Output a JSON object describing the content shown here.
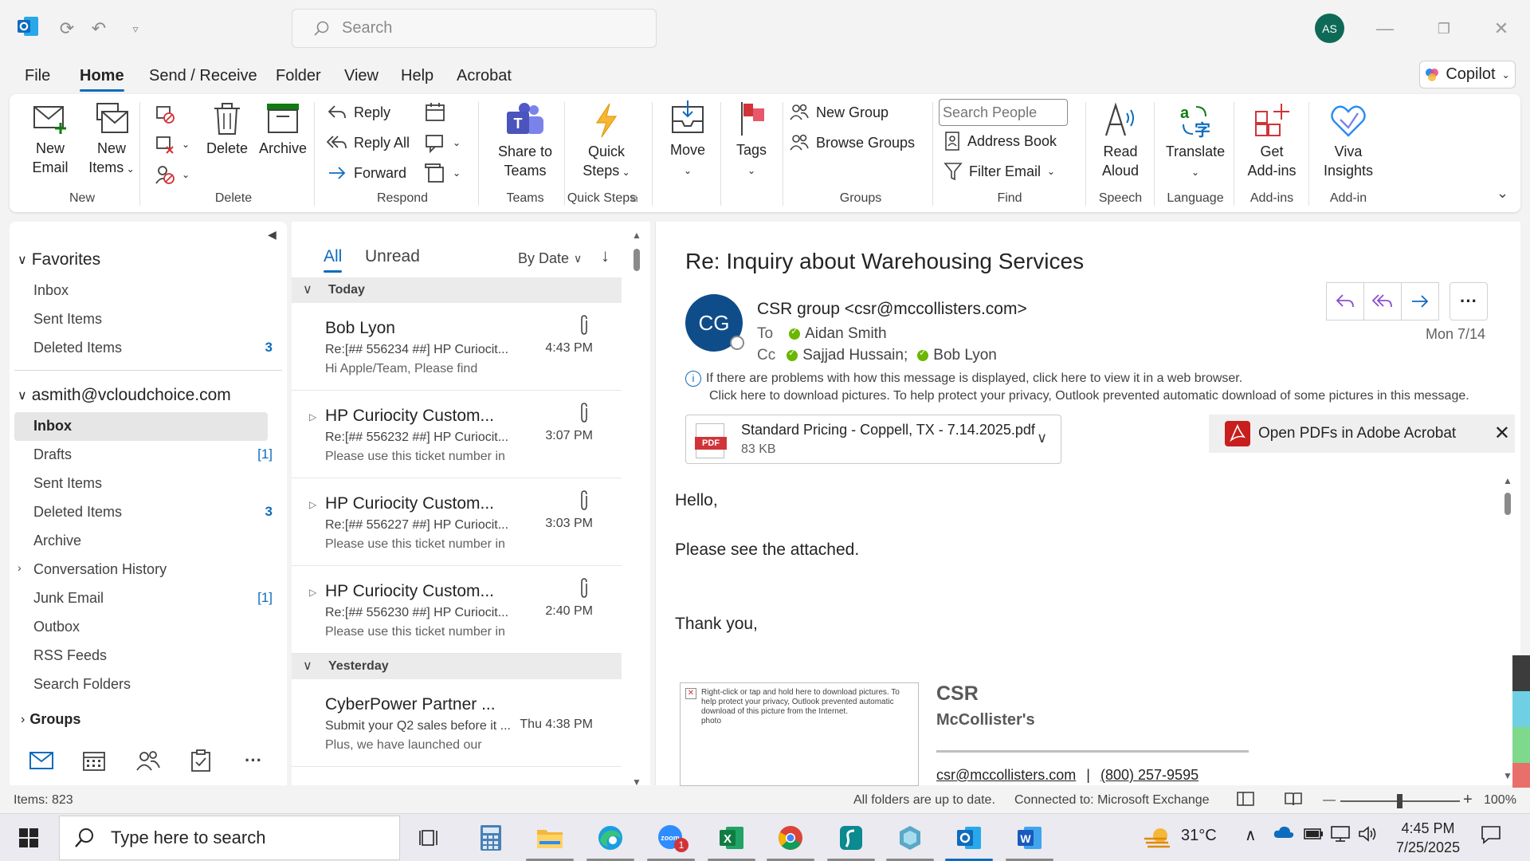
{
  "titlebar": {
    "search_placeholder": "Search",
    "avatar_initials": "AS"
  },
  "menu": {
    "tabs": [
      "File",
      "Home",
      "Send / Receive",
      "Folder",
      "View",
      "Help",
      "Acrobat"
    ],
    "active": "Home",
    "copilot_label": "Copilot"
  },
  "ribbon": {
    "new_email": [
      "New",
      "Email"
    ],
    "new_items": [
      "New",
      "Items"
    ],
    "delete": "Delete",
    "archive": "Archive",
    "reply": "Reply",
    "reply_all": "Reply All",
    "forward": "Forward",
    "share_to_teams": [
      "Share to",
      "Teams"
    ],
    "quick_steps": [
      "Quick",
      "Steps"
    ],
    "move": "Move",
    "tags": "Tags",
    "new_group": "New Group",
    "browse_groups": "Browse Groups",
    "search_people_placeholder": "Search People",
    "address_book": "Address Book",
    "filter_email": "Filter Email",
    "read_aloud": [
      "Read",
      "Aloud"
    ],
    "translate": "Translate",
    "get_addins": [
      "Get",
      "Add-ins"
    ],
    "viva_insights": [
      "Viva",
      "Insights"
    ],
    "groups": {
      "new": "New",
      "delete": "Delete",
      "respond": "Respond",
      "teams": "Teams",
      "quick_steps": "Quick Steps",
      "groups": "Groups",
      "find": "Find",
      "speech": "Speech",
      "language": "Language",
      "addins": "Add-ins",
      "addin": "Add-in"
    }
  },
  "folders": {
    "favorites_header": "Favorites",
    "favorites": [
      {
        "name": "Inbox",
        "count": ""
      },
      {
        "name": "Sent Items",
        "count": ""
      },
      {
        "name": "Deleted Items",
        "count": "3"
      }
    ],
    "account_header": "asmith@vcloudchoice.com",
    "account_folders": [
      {
        "name": "Inbox",
        "count": ""
      },
      {
        "name": "Drafts",
        "count": "[1]"
      },
      {
        "name": "Sent Items",
        "count": ""
      },
      {
        "name": "Deleted Items",
        "count": "3"
      },
      {
        "name": "Archive",
        "count": ""
      },
      {
        "name": "Conversation History",
        "count": ""
      },
      {
        "name": "Junk Email",
        "count": "[1]"
      },
      {
        "name": "Outbox",
        "count": ""
      },
      {
        "name": "RSS Feeds",
        "count": ""
      },
      {
        "name": "Search Folders",
        "count": ""
      }
    ],
    "groups_header": "Groups"
  },
  "message_list": {
    "tab_all": "All",
    "tab_unread": "Unread",
    "sort_label": "By Date",
    "group_today": "Today",
    "group_yesterday": "Yesterday",
    "items": [
      {
        "sender": "Bob Lyon",
        "subject": "Re:[## 556234 ##] HP Curiocit...",
        "preview": "Hi Apple/Team,  Please find",
        "time": "4:43 PM"
      },
      {
        "sender": "HP Curiocity Custom...",
        "subject": "Re:[## 556232 ##] HP Curiocit...",
        "preview": "Please use this ticket number in",
        "time": "3:07 PM"
      },
      {
        "sender": "HP Curiocity Custom...",
        "subject": "Re:[## 556227 ##] HP Curiocit...",
        "preview": "Please use this ticket number in",
        "time": "3:03 PM"
      },
      {
        "sender": "HP Curiocity Custom...",
        "subject": "Re:[## 556230 ##] HP Curiocit...",
        "preview": "Please use this ticket number in",
        "time": "2:40 PM"
      },
      {
        "sender": "CyberPower Partner ...",
        "subject": "Submit your Q2 sales before it ...",
        "preview": "Plus, we have launched our",
        "time": "Thu 4:38 PM"
      }
    ]
  },
  "reading": {
    "subject": "Re: Inquiry about Warehousing Services",
    "avatar_initials": "CG",
    "from": "CSR group <csr@mccollisters.com>",
    "to_label": "To",
    "to": "Aidan Smith",
    "cc_label": "Cc",
    "cc1": "Sajjad Hussain;",
    "cc2": "Bob Lyon",
    "date": "Mon 7/14",
    "info_line1": "If there are problems with how this message is displayed, click here to view it in a web browser.",
    "info_line2": "Click here to download pictures. To help protect your privacy, Outlook prevented automatic download of some pictures in this message.",
    "attachment_name": "Standard Pricing - Coppell, TX - 7.14.2025.pdf",
    "attachment_size": "83 KB",
    "attachment_badge": "PDF",
    "pdf_banner": "Open PDFs in Adobe Acrobat",
    "body_hello": "Hello,",
    "body_line": "Please see the attached.",
    "body_thanks": "Thank you,",
    "sig_placeholder": "Right-click or tap and hold here to download pictures. To help protect your privacy, Outlook prevented automatic download of this picture from the Internet.\nphoto",
    "sig_name1": "CSR",
    "sig_name2": "McCollister's",
    "sig_email": "csr@mccollisters.com",
    "sig_sep": "|",
    "sig_phone": "(800) 257-9595"
  },
  "status": {
    "items": "Items: 823",
    "sync": "All folders are up to date.",
    "connection": "Connected to: Microsoft Exchange",
    "zoom": "100%"
  },
  "taskbar": {
    "search_placeholder": "Type here to search",
    "weather": "31°C",
    "time": "4:45 PM",
    "date": "7/25/2025",
    "zoom_badge": "1"
  }
}
